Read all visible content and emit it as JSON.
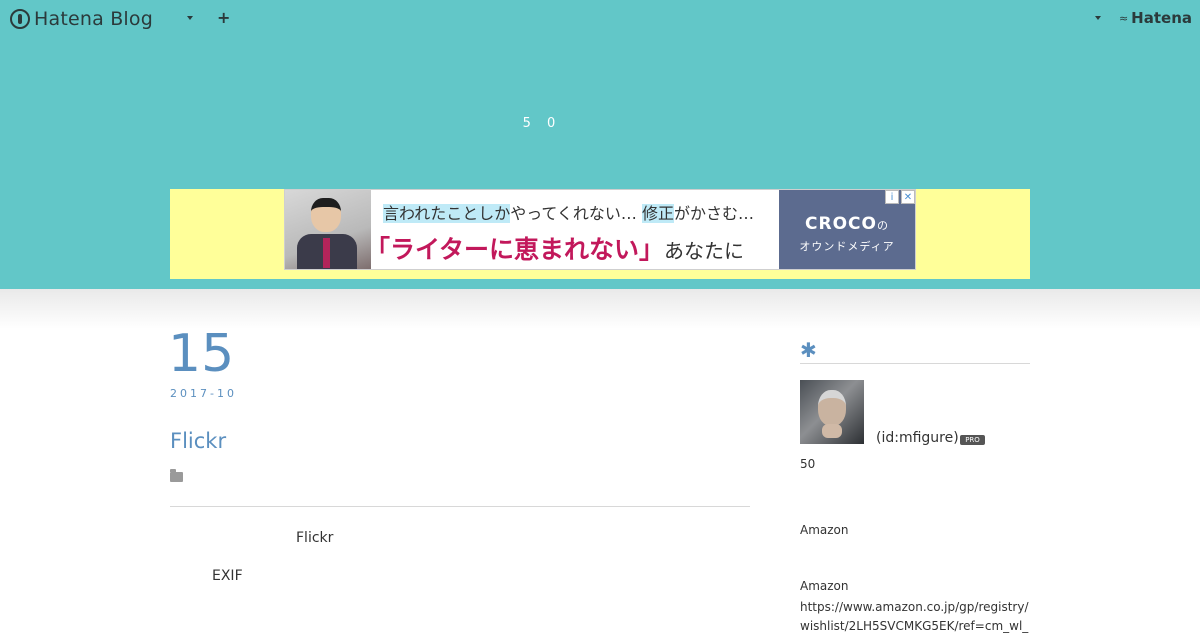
{
  "colors": {
    "header_bg": "#62c7c8",
    "accent": "#5b8fbf",
    "ad_bg": "#ffff99"
  },
  "topbar": {
    "brand": "Hatena Blog",
    "brand_icon": "hatena-blog-logo-icon",
    "blog_menu_icon": "caret-down-icon",
    "add_icon": "plus-icon",
    "plus_glyph": "+",
    "account_menu_icon": "caret-down-icon",
    "hatena_logo": "Hatena",
    "hatena_logo_mark": "≈"
  },
  "blog_description": "5 0",
  "ad": {
    "line1_prefix": "言われたことしか",
    "line1_mid": "やってくれない…",
    "line1_hl": "修正",
    "line1_suffix": "がかさむ…",
    "line2_main": "「ライターに恵まれない」",
    "line2_tail": "あなたに",
    "brand_logo": "CROCO",
    "brand_logo_suffix": "の",
    "brand_sub": "オウンドメディア",
    "adchoices_info": "i",
    "adchoices_close": "✕"
  },
  "entry": {
    "day": "15",
    "year_month": "2017-10",
    "title": "Flickr",
    "category_icon": "folder-icon",
    "paragraph1": "Flickr",
    "paragraph2": "EXIF"
  },
  "sidebar": {
    "section_heading": "✱",
    "user_id": "(id:mfigure)",
    "pro_badge": "PRO",
    "text1": "50",
    "text2": "Amazon",
    "text3": "Amazon",
    "url": "https://www.amazon.co.jp/gp/registry/wishlist/2LH5SVCMKG5EK/ref=cm_wl_"
  }
}
